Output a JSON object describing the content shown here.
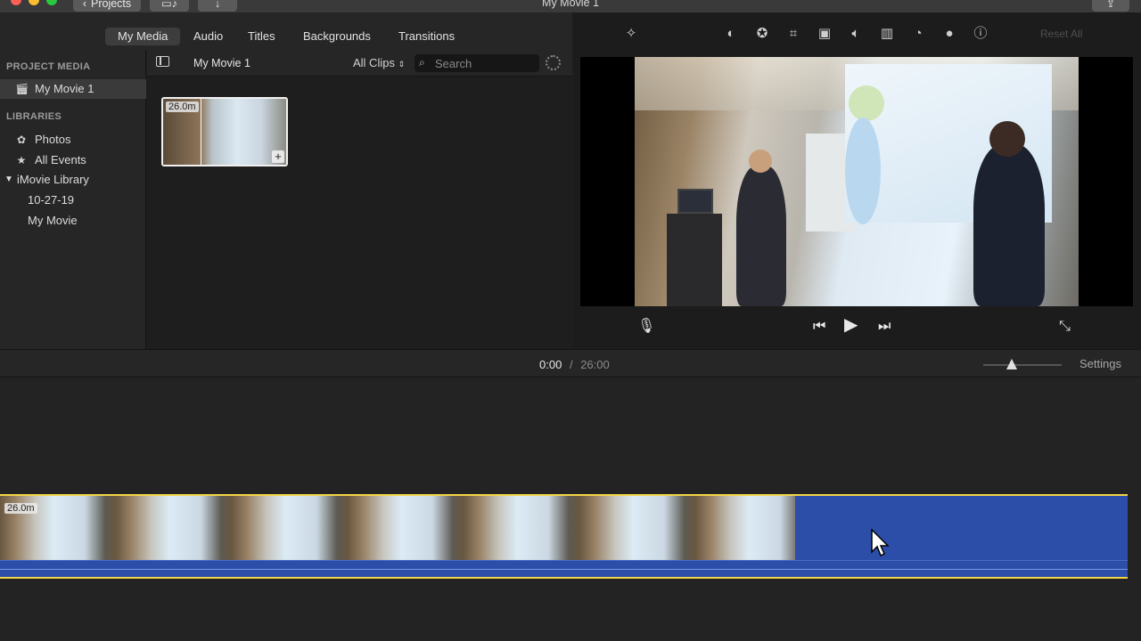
{
  "window": {
    "title": "My Movie 1",
    "back_button": "Projects"
  },
  "browser_tabs": [
    "My Media",
    "Audio",
    "Titles",
    "Backgrounds",
    "Transitions"
  ],
  "sidebar": {
    "project_media_heading": "PROJECT MEDIA",
    "project_item": "My Movie 1",
    "libraries_heading": "LIBRARIES",
    "items": [
      "Photos",
      "All Events",
      "iMovie Library",
      "10-27-19",
      "My Movie"
    ]
  },
  "media": {
    "title": "My Movie 1",
    "filter": "All Clips",
    "search_placeholder": "Search",
    "clip_duration": "26.0m"
  },
  "viewer": {
    "reset_all": "Reset All",
    "tools": [
      "magic-wand-icon",
      "color-balance-icon",
      "color-correction-icon",
      "crop-icon",
      "stabilization-icon",
      "volume-icon",
      "noise-reduction-icon",
      "speed-icon",
      "clip-filter-icon",
      "info-icon"
    ]
  },
  "timeline": {
    "current_time": "0:00",
    "separator": "/",
    "total_time": "26:00",
    "settings_label": "Settings",
    "clip_duration": "26.0m"
  }
}
